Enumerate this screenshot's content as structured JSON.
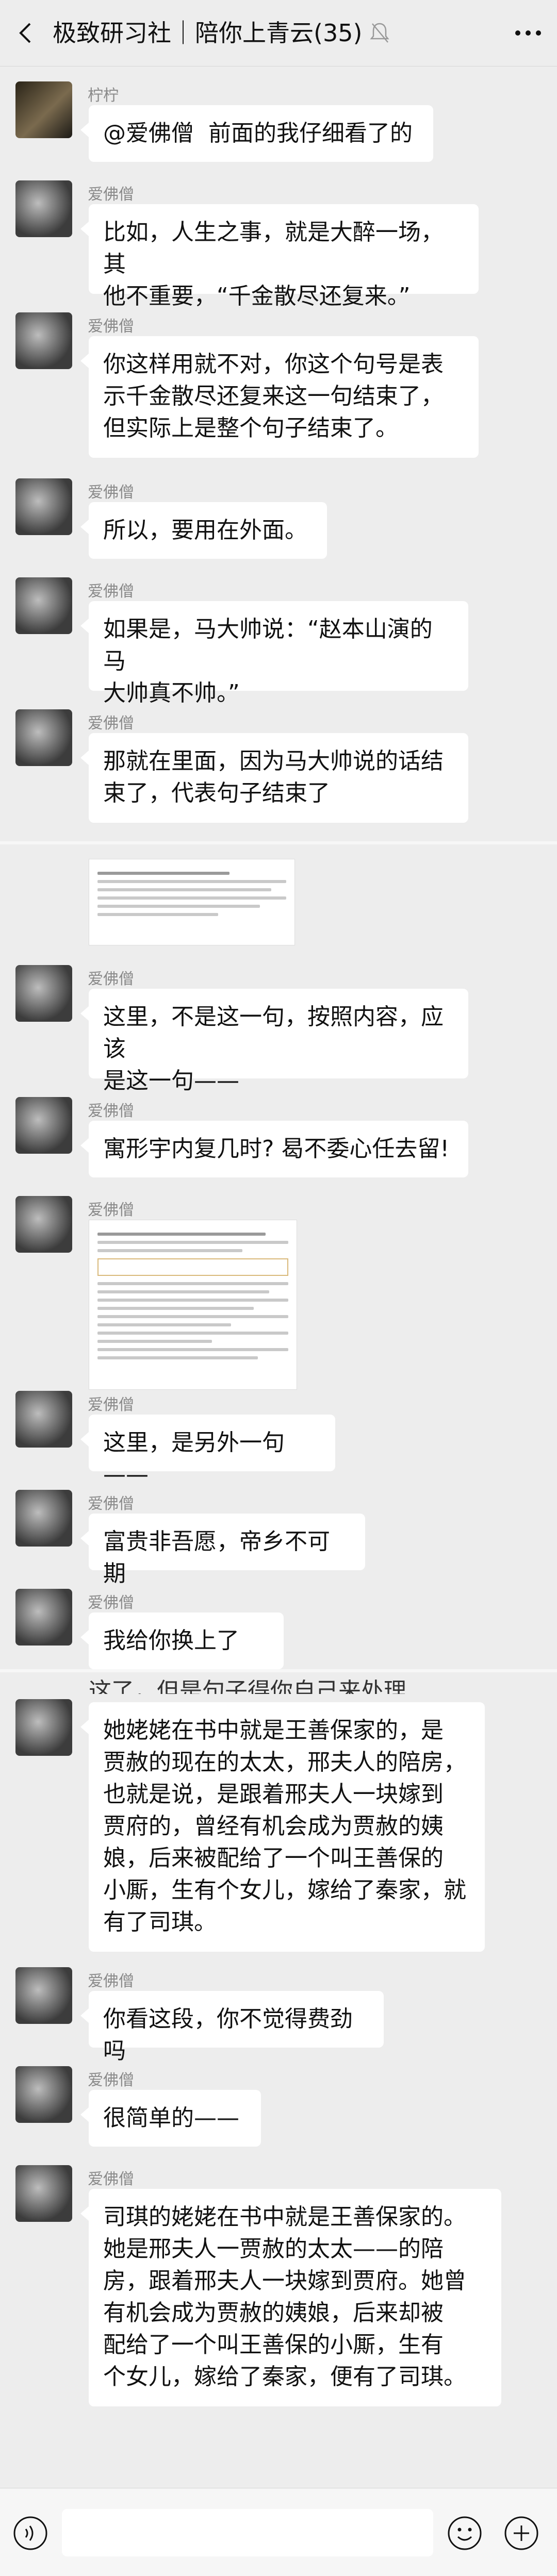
{
  "header": {
    "title": "极致研习社｜陪你上青云(35)"
  },
  "messages": [
    {
      "sender": "柠柠",
      "text": "@爱佛僧  前面的我仔细看了的"
    },
    {
      "sender": "爱佛僧",
      "text": "比如，人生之事，就是大醉一场，其\n他不重要，“千金散尽还复来。”"
    },
    {
      "sender": "爱佛僧",
      "text": "你这样用就不对，你这个句号是表\n示千金散尽还复来这一句结束了，\n但实际上是整个句子结束了。"
    },
    {
      "sender": "爱佛僧",
      "text": "所以，要用在外面。"
    },
    {
      "sender": "爱佛僧",
      "text": "如果是，马大帅说：“赵本山演的马\n大帅真不帅。”"
    },
    {
      "sender": "爱佛僧",
      "text": "那就在里面，因为马大帅说的话结\n束了，代表句子结束了"
    },
    {
      "sender": "爱佛僧",
      "text": "这里，不是这一句，按照内容，应该\n是这一句——"
    },
    {
      "sender": "爱佛僧",
      "text": "寓形宇内复几时? 曷不委心任去留!"
    },
    {
      "sender": "爱佛僧",
      "text": "这里，是另外一句——"
    },
    {
      "sender": "爱佛僧",
      "text": "富贵非吾愿，帝乡不可期"
    },
    {
      "sender": "爱佛僧",
      "text": "我给你换上了"
    },
    {
      "sender": "爱佛僧",
      "text": "她姥姥在书中就是王善保家的，是\n贾赦的现在的太太，邢夫人的陪房，\n也就是说，是跟着邢夫人一块嫁到\n贾府的，曾经有机会成为贾赦的姨\n娘，后来被配给了一个叫王善保的\n小厮，生有个女儿，嫁给了秦家，就\n有了司琪。"
    },
    {
      "sender": "爱佛僧",
      "text": "你看这段，你不觉得费劲吗"
    },
    {
      "sender": "爱佛僧",
      "text": "很简单的——"
    },
    {
      "sender": "爱佛僧",
      "text": "司琪的姥姥在书中就是王善保家的。\n她是邢夫人一贾赦的太太——的陪\n房，跟着邢夫人一块嫁到贾府。她曾\n有机会成为贾赦的姨娘，后来却被\n配给了一个叫王善保的小厮，生有\n个女儿，嫁给了秦家，便有了司琪。"
    }
  ],
  "cut_text": "这了，但是句子得你自己来处理"
}
